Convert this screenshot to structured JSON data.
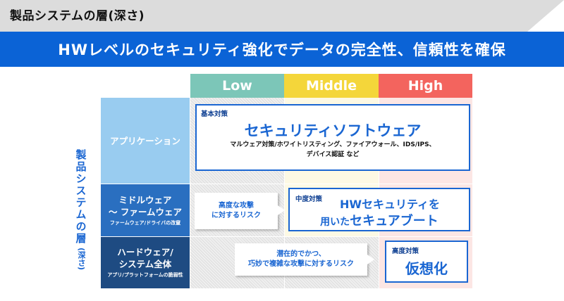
{
  "page": {
    "title": "製品システムの層(深さ)",
    "banner": "HWレベルのセキュリティ強化でデータの完全性、信頼性を確保"
  },
  "levels": [
    {
      "label": "Low",
      "color": "#7cc6b8"
    },
    {
      "label": "Middle",
      "color": "#f4d63a"
    },
    {
      "label": "High",
      "color": "#f3645e"
    }
  ],
  "axis": {
    "main": "製品システムの層",
    "sub": "(深さ)"
  },
  "rows": [
    {
      "main": "アプリケーション",
      "sub": "",
      "color": "#99ccf0"
    },
    {
      "main_lines": [
        "ミドルウェア",
        "〜 ファームウェア"
      ],
      "sub": "ファームウェア/ドライバの改竄",
      "color": "#2a6fc0"
    },
    {
      "main_lines": [
        "ハードウェア/",
        "システム全体"
      ],
      "sub": "アプリ/プラットフォームの脆弱性",
      "color": "#1e4b82"
    }
  ],
  "basic": {
    "tag": "基本対策",
    "title": "セキュリティソフトウェア",
    "desc1": "マルウェア対策/ホワイトリスティング、ファイアウォール、IDS/IPS、",
    "desc2": "デバイス認証 など"
  },
  "middle": {
    "tag": "中度対策",
    "line1": "HWセキュリティを",
    "line2a": "用いた",
    "line2b": "セキュアブート"
  },
  "high": {
    "tag": "高度対策",
    "title": "仮想化"
  },
  "risk1": {
    "line1": "高度な攻撃",
    "line2": "に対するリスク"
  },
  "risk2": {
    "line1": "潜在的でかつ、",
    "line2": "巧妙で複雑な攻撃に対するリスク"
  }
}
